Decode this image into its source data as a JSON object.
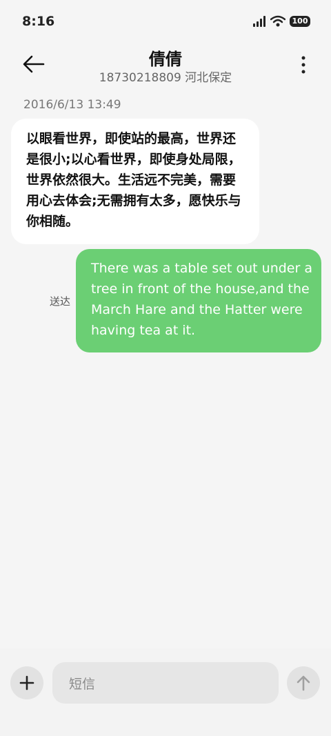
{
  "status_bar": {
    "time": "8:16",
    "battery": "100"
  },
  "header": {
    "contact_name": "倩倩",
    "contact_info": "18730218809 河北保定"
  },
  "conversation": {
    "timestamp": "2016/6/13 13:49",
    "incoming_message": "以眼看世界，即使站的最高，世界还是很小;以心看世界，即使身处局限，世界依然很大。生活远不完美，需要用心去体会;无需拥有太多，愿快乐与你相随。",
    "outgoing_message": "There was a table set out under a tree in front of the house,and the March Hare and the Hatter were having tea at it.",
    "delivery_status": "送达"
  },
  "composer": {
    "placeholder": "短信"
  },
  "colors": {
    "outgoing_bubble": "#6bcf74",
    "background": "#f5f5f5"
  },
  "icons": [
    "signal-icon",
    "wifi-icon",
    "battery-icon",
    "back-arrow-icon",
    "more-icon",
    "plus-icon",
    "send-arrow-icon"
  ]
}
